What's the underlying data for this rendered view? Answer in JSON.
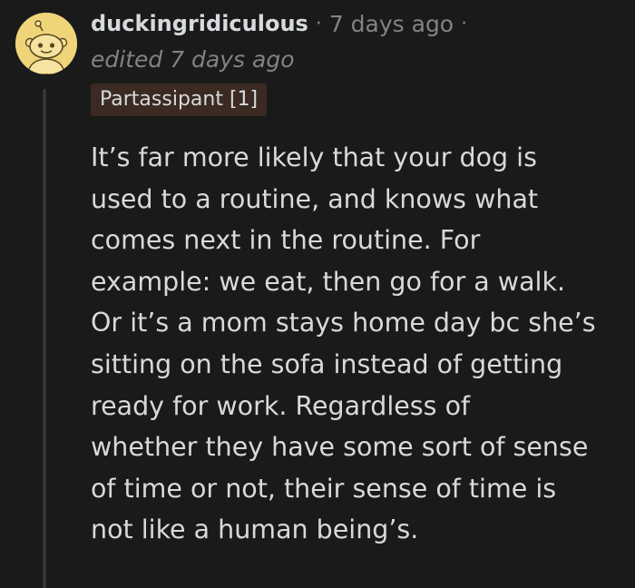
{
  "comment": {
    "author": "duckingridiculous",
    "separator": "·",
    "posted": "7 days ago",
    "edited": "edited 7 days ago",
    "flair": "Partassipant [1]",
    "avatar_icon": "snoo-avatar-icon",
    "body_lines": [
      "It’s far more likely that your dog is",
      "used to a routine, and knows what",
      "comes next in the routine. For",
      "example: we eat, then go for a walk.",
      "Or it’s a mom stays home day bc she’s",
      "sitting on the sofa instead of getting",
      "ready for work. Regardless of",
      "whether they have some sort of sense",
      "of time or not, their sense of time is",
      "not like a human being’s."
    ]
  },
  "colors": {
    "background": "#1a1a1b",
    "text": "#d7dadc",
    "muted": "#818384",
    "flair_bg": "#3b2a21",
    "avatar_bg": "#f0d47a"
  }
}
